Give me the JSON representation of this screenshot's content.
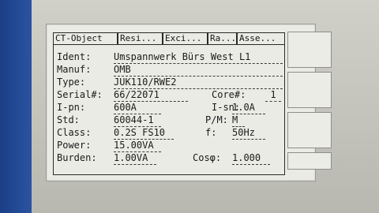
{
  "tabs": [
    "CT-Object",
    "Resi...",
    "Exci...",
    "Ra...",
    "Asse..."
  ],
  "fields": {
    "ident": {
      "label": "Ident:",
      "value": "Umspannwerk Bürs West L1"
    },
    "manuf": {
      "label": "Manuf:",
      "value": "OMB"
    },
    "type": {
      "label": "Type:",
      "value": "JUK110/RWE2"
    },
    "serial": {
      "label": "Serial#:",
      "value": "66/22071"
    },
    "core": {
      "label": "Core#:",
      "value": "1"
    },
    "ipn": {
      "label": "I-pn:",
      "value": "600A"
    },
    "isn": {
      "label": "I-sn:",
      "value": "1.0A"
    },
    "std": {
      "label": "Std:",
      "value": "60044-1"
    },
    "pm": {
      "label": "P/M:",
      "value": "M"
    },
    "class": {
      "label": "Class:",
      "value": "0.2S FS10"
    },
    "f": {
      "label": "f:",
      "value": "50Hz"
    },
    "power": {
      "label": "Power:",
      "value": "15.00VA"
    },
    "burden": {
      "label": "Burden:",
      "value": "1.00VA"
    },
    "cosphi": {
      "label": "Cosφ:",
      "value": "1.000"
    }
  },
  "colors": {
    "side_strip": "#1f4690",
    "screen_bg": "#ebebe6",
    "text": "#1a1a1a"
  }
}
